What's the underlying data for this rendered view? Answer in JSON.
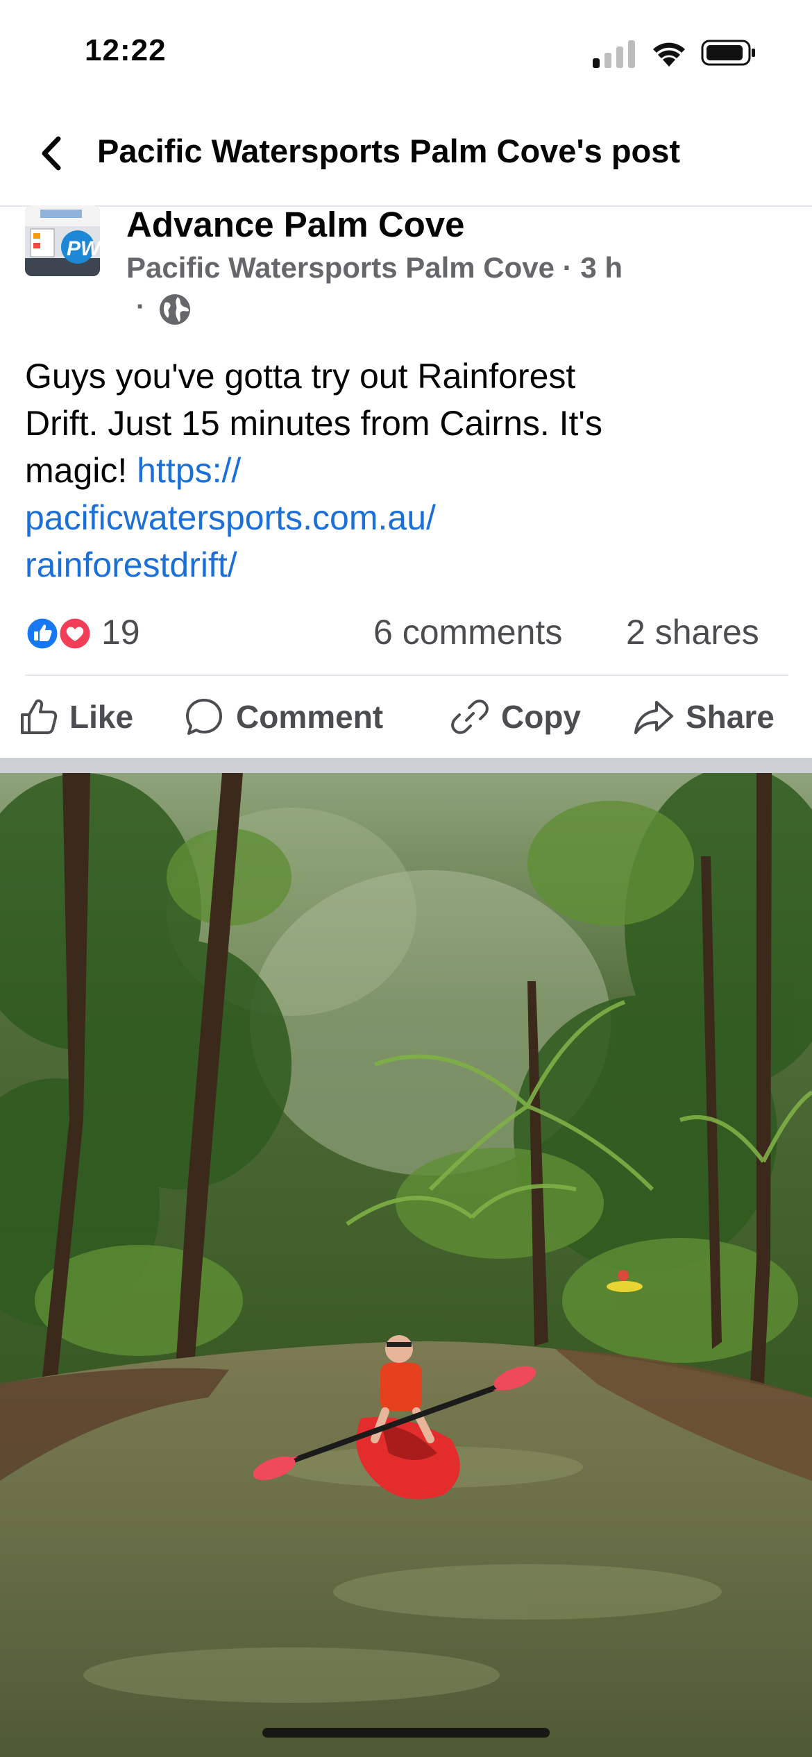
{
  "status_bar": {
    "time": "12:22"
  },
  "header": {
    "title": "Pacific Watersports Palm Cove's post"
  },
  "post": {
    "author": "Advance Palm Cove",
    "page_name": "Pacific Watersports Palm Cove",
    "separator": "·",
    "time": "3 h",
    "text_lines": [
      "Guys you've gotta try out Rainforest",
      "Drift.  Just 15 minutes from Cairns. It's",
      "magic! "
    ],
    "link_parts": [
      "https://",
      "pacificwatersports.com.au/",
      "rainforestdrift/"
    ],
    "reactions_count": "19",
    "comments": "6 comments",
    "shares": "2 shares",
    "reaction_types": [
      "like-icon",
      "love-icon"
    ]
  },
  "actions": {
    "like": "Like",
    "comment": "Comment",
    "copy": "Copy",
    "share": "Share"
  },
  "colors": {
    "link": "#1b6fd6",
    "like_blue": "#1877f2",
    "love_red": "#f33e58",
    "secondary_text": "#65676b"
  }
}
